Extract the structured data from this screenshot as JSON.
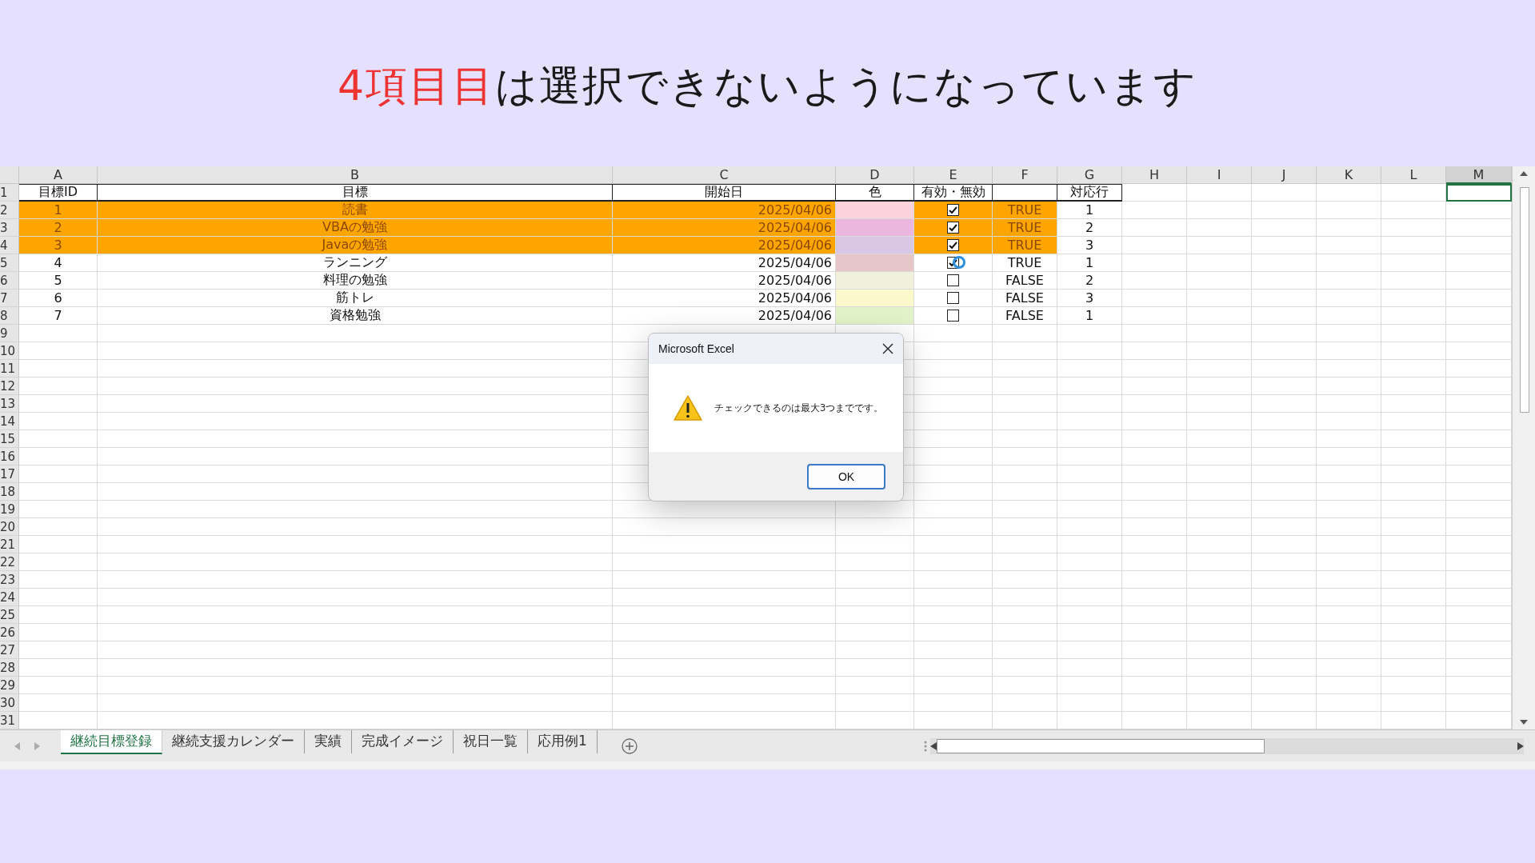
{
  "title": {
    "highlight": "4項目目",
    "rest": "は選択できないようになっています"
  },
  "columns": [
    {
      "label": "A",
      "selected": false
    },
    {
      "label": "B",
      "selected": false
    },
    {
      "label": "C",
      "selected": false
    },
    {
      "label": "D",
      "selected": false
    },
    {
      "label": "E",
      "selected": false
    },
    {
      "label": "F",
      "selected": false
    },
    {
      "label": "G",
      "selected": false
    },
    {
      "label": "H",
      "selected": false
    },
    {
      "label": "I",
      "selected": false
    },
    {
      "label": "J",
      "selected": false
    },
    {
      "label": "K",
      "selected": false
    },
    {
      "label": "L",
      "selected": false
    },
    {
      "label": "M",
      "selected": true
    }
  ],
  "header": {
    "A": "目標ID",
    "B": "目標",
    "C": "開始日",
    "D": "色",
    "E": "有効・無効",
    "G": "対応行"
  },
  "row_numbers": [
    "1",
    "2",
    "3",
    "4",
    "5",
    "6",
    "7",
    "8",
    "9",
    "10",
    "11",
    "12",
    "13",
    "14",
    "15",
    "16",
    "17",
    "18",
    "19",
    "20",
    "21",
    "22",
    "23",
    "24",
    "25",
    "26",
    "27",
    "28",
    "29",
    "30",
    "31"
  ],
  "rows": [
    {
      "id": "1",
      "goal": "読書",
      "start_date": "2025/04/06",
      "color": "#fbd3dd",
      "checked": true,
      "status": "TRUE",
      "line": "1",
      "highlighted": true,
      "pointer": false
    },
    {
      "id": "2",
      "goal": "VBAの勉強",
      "start_date": "2025/04/06",
      "color": "#ebb7df",
      "checked": true,
      "status": "TRUE",
      "line": "2",
      "highlighted": true,
      "pointer": false
    },
    {
      "id": "3",
      "goal": "Javaの勉強",
      "start_date": "2025/04/06",
      "color": "#d8c8e3",
      "checked": true,
      "status": "TRUE",
      "line": "3",
      "highlighted": true,
      "pointer": false
    },
    {
      "id": "4",
      "goal": "ランニング",
      "start_date": "2025/04/06",
      "color": "#e6c6c9",
      "checked": true,
      "status": "TRUE",
      "line": "1",
      "highlighted": false,
      "pointer": true
    },
    {
      "id": "5",
      "goal": "料理の勉強",
      "start_date": "2025/04/06",
      "color": "#f1f0dd",
      "checked": false,
      "status": "FALSE",
      "line": "2",
      "highlighted": false,
      "pointer": false
    },
    {
      "id": "6",
      "goal": "筋トレ",
      "start_date": "2025/04/06",
      "color": "#fbf9cc",
      "checked": false,
      "status": "FALSE",
      "line": "3",
      "highlighted": false,
      "pointer": false
    },
    {
      "id": "7",
      "goal": "資格勉強",
      "start_date": "2025/04/06",
      "color": "#e3f3c9",
      "checked": false,
      "status": "FALSE",
      "line": "1",
      "highlighted": false,
      "pointer": false
    }
  ],
  "sheet_tabs": [
    {
      "label": "継続目標登録",
      "selected": true
    },
    {
      "label": "継続支援カレンダー",
      "selected": false
    },
    {
      "label": "実績",
      "selected": false
    },
    {
      "label": "完成イメージ",
      "selected": false
    },
    {
      "label": "祝日一覧",
      "selected": false
    },
    {
      "label": "応用例1",
      "selected": false
    }
  ],
  "dialog": {
    "title": "Microsoft Excel",
    "message": "チェックできるのは最大3つまでです。",
    "button": "OK"
  }
}
